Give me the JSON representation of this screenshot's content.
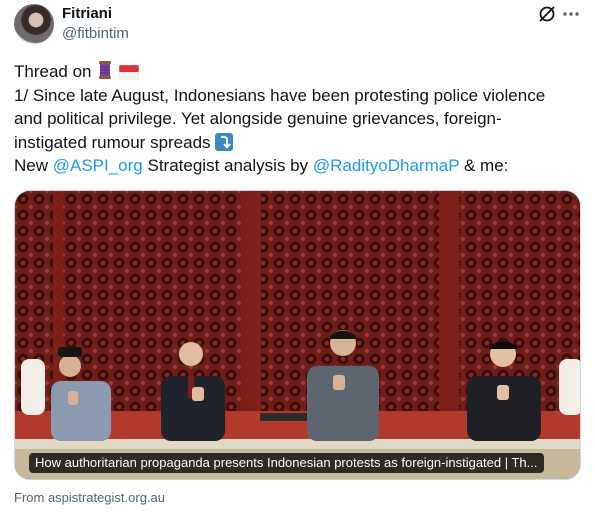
{
  "author": {
    "name": "Fitriani",
    "handle": "@fitbintim"
  },
  "tweet": {
    "line1": "Thread on",
    "line2": "1/ Since late August, Indonesians have been protesting police violence",
    "line3": "and political privilege. Yet alongside genuine grievances, foreign-",
    "line4": "instigated rumour spreads",
    "line5_pre": "New ",
    "mention1": "@ASPI_org",
    "line5_mid": " Strategist analysis by ",
    "mention2": "@RadityoDharmaP",
    "line5_post": " & me:"
  },
  "card": {
    "caption": "How authoritarian propaganda presents Indonesian protests as foreign-instigated | Th...",
    "source": "From aspistrategist.org.au"
  },
  "icons": {
    "grok": "grok-icon",
    "more": "more-dots-icon",
    "thread": "spool-of-thread-emoji",
    "flag": "indonesia-flag-emoji",
    "arrow": "arrow-curving-down-emoji"
  },
  "colors": {
    "link": "#1d9bf0",
    "text": "#0f1419",
    "secondary": "#536471"
  }
}
